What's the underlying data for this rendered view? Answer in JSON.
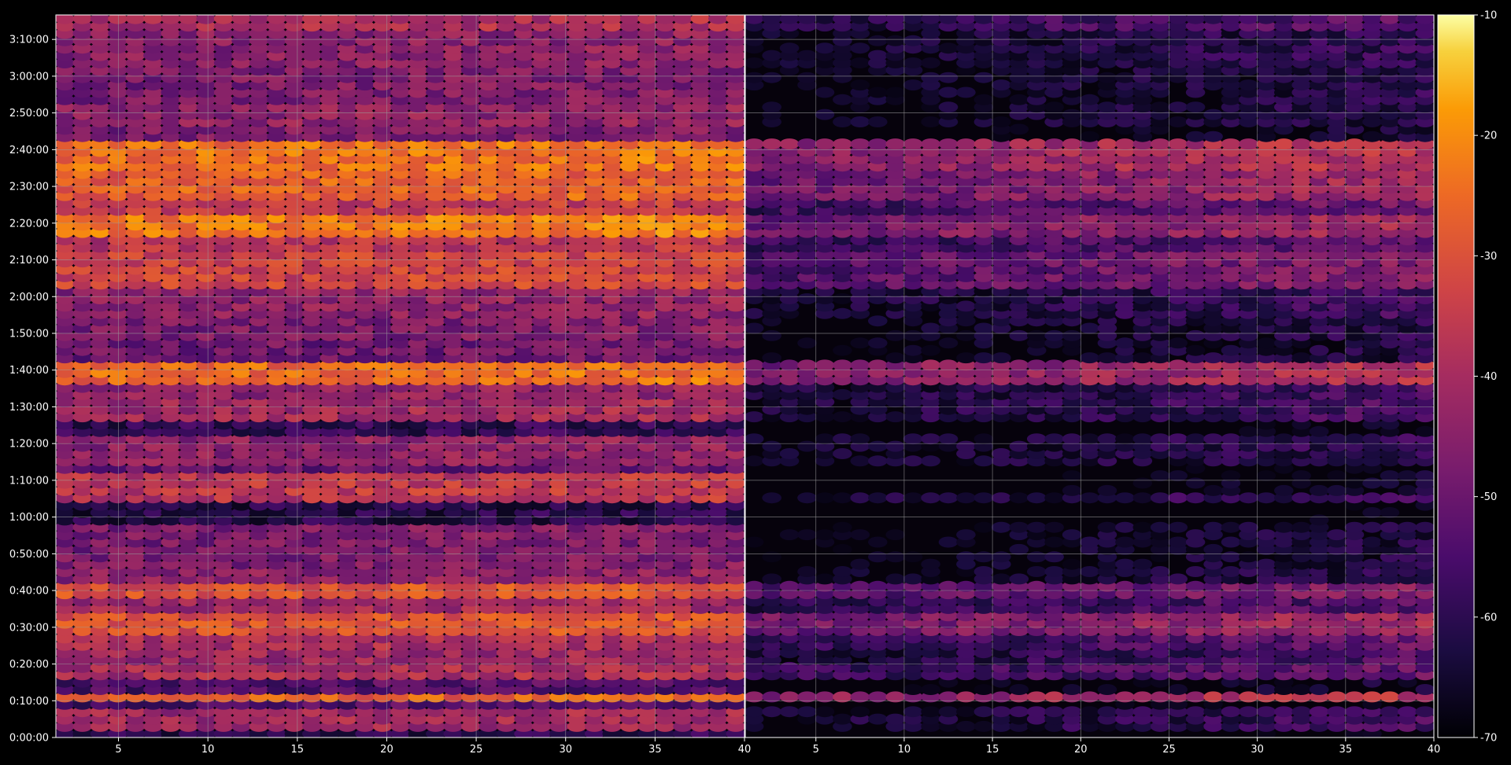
{
  "chart_data": {
    "type": "heatmap",
    "title": "",
    "xlabel": "",
    "ylabel": "",
    "panels": [
      {
        "name": "",
        "x_range": [
          1.5,
          40
        ],
        "x_ticks": [
          5,
          10,
          15,
          20,
          25,
          30,
          35,
          40
        ]
      },
      {
        "name": "",
        "x_range": [
          1,
          40
        ],
        "x_ticks": [
          5,
          10,
          15,
          20,
          25,
          30,
          35,
          40
        ]
      }
    ],
    "y_range_seconds": [
      0,
      11800
    ],
    "y_ticks": [
      {
        "seconds": 0,
        "label": "0:00:00"
      },
      {
        "seconds": 600,
        "label": "0:10:00"
      },
      {
        "seconds": 1200,
        "label": "0:20:00"
      },
      {
        "seconds": 1800,
        "label": "0:30:00"
      },
      {
        "seconds": 2400,
        "label": "0:40:00"
      },
      {
        "seconds": 3000,
        "label": "0:50:00"
      },
      {
        "seconds": 3600,
        "label": "1:00:00"
      },
      {
        "seconds": 4200,
        "label": "1:10:00"
      },
      {
        "seconds": 4800,
        "label": "1:20:00"
      },
      {
        "seconds": 5400,
        "label": "1:30:00"
      },
      {
        "seconds": 6000,
        "label": "1:40:00"
      },
      {
        "seconds": 6600,
        "label": "1:50:00"
      },
      {
        "seconds": 7200,
        "label": "2:00:00"
      },
      {
        "seconds": 7800,
        "label": "2:10:00"
      },
      {
        "seconds": 8400,
        "label": "2:20:00"
      },
      {
        "seconds": 9000,
        "label": "2:30:00"
      },
      {
        "seconds": 9600,
        "label": "2:40:00"
      },
      {
        "seconds": 10200,
        "label": "2:50:00"
      },
      {
        "seconds": 10800,
        "label": "3:00:00"
      },
      {
        "seconds": 11400,
        "label": "3:10:00"
      }
    ],
    "band_profile": [
      {
        "t_start": 0,
        "t_end": 120,
        "left": -62,
        "right": -70
      },
      {
        "t_start": 120,
        "t_end": 450,
        "left": -42,
        "right": -56
      },
      {
        "t_start": 450,
        "t_end": 560,
        "left": -55,
        "right": -68
      },
      {
        "t_start": 560,
        "t_end": 700,
        "left": -28,
        "right": -36
      },
      {
        "t_start": 700,
        "t_end": 960,
        "left": -55,
        "right": -65
      },
      {
        "t_start": 960,
        "t_end": 1240,
        "left": -40,
        "right": -50
      },
      {
        "t_start": 1240,
        "t_end": 1500,
        "left": -43,
        "right": -54
      },
      {
        "t_start": 1500,
        "t_end": 1700,
        "left": -40,
        "right": -50
      },
      {
        "t_start": 1700,
        "t_end": 2000,
        "left": -31,
        "right": -40
      },
      {
        "t_start": 2000,
        "t_end": 2300,
        "left": -42,
        "right": -52
      },
      {
        "t_start": 2300,
        "t_end": 2480,
        "left": -30,
        "right": -45
      },
      {
        "t_start": 2480,
        "t_end": 2800,
        "left": -45,
        "right": -60
      },
      {
        "t_start": 2800,
        "t_end": 3500,
        "left": -48,
        "right": -62
      },
      {
        "t_start": 3500,
        "t_end": 3800,
        "left": -62,
        "right": -70
      },
      {
        "t_start": 3800,
        "t_end": 4000,
        "left": -38,
        "right": -56
      },
      {
        "t_start": 4000,
        "t_end": 4300,
        "left": -37,
        "right": -66
      },
      {
        "t_start": 4300,
        "t_end": 4500,
        "left": -52,
        "right": -69
      },
      {
        "t_start": 4500,
        "t_end": 4900,
        "left": -45,
        "right": -58
      },
      {
        "t_start": 4900,
        "t_end": 5200,
        "left": -60,
        "right": -69
      },
      {
        "t_start": 5200,
        "t_end": 5500,
        "left": -42,
        "right": -55
      },
      {
        "t_start": 5500,
        "t_end": 5800,
        "left": -45,
        "right": -55
      },
      {
        "t_start": 5800,
        "t_end": 6150,
        "left": -26,
        "right": -38
      },
      {
        "t_start": 6150,
        "t_end": 6500,
        "left": -50,
        "right": -62
      },
      {
        "t_start": 6500,
        "t_end": 6900,
        "left": -48,
        "right": -60
      },
      {
        "t_start": 6900,
        "t_end": 7300,
        "left": -45,
        "right": -56
      },
      {
        "t_start": 7300,
        "t_end": 7900,
        "left": -34,
        "right": -45
      },
      {
        "t_start": 7900,
        "t_end": 8200,
        "left": -38,
        "right": -50
      },
      {
        "t_start": 8200,
        "t_end": 8600,
        "left": -24,
        "right": -40
      },
      {
        "t_start": 8600,
        "t_end": 8800,
        "left": -36,
        "right": -48
      },
      {
        "t_start": 8800,
        "t_end": 9300,
        "left": -28,
        "right": -40
      },
      {
        "t_start": 9300,
        "t_end": 9800,
        "left": -25,
        "right": -36
      },
      {
        "t_start": 9800,
        "t_end": 10000,
        "left": -48,
        "right": -65
      },
      {
        "t_start": 10000,
        "t_end": 10400,
        "left": -45,
        "right": -60
      },
      {
        "t_start": 10400,
        "t_end": 10900,
        "left": -48,
        "right": -60
      },
      {
        "t_start": 10900,
        "t_end": 11500,
        "left": -46,
        "right": -58
      },
      {
        "t_start": 11500,
        "t_end": 11800,
        "left": -40,
        "right": -52
      }
    ],
    "colorbar": {
      "colormap": "inferno",
      "range": [
        -70,
        -10
      ],
      "ticks": [
        {
          "value": -10,
          "label": "-10"
        },
        {
          "value": -20,
          "label": "-20"
        },
        {
          "value": -30,
          "label": "-30"
        },
        {
          "value": -40,
          "label": "-40"
        },
        {
          "value": -50,
          "label": "-50"
        },
        {
          "value": -60,
          "label": "-60"
        },
        {
          "value": -70,
          "label": "-70"
        }
      ]
    },
    "grid": true,
    "colors": {
      "background": "#000000",
      "grid": "#9a9a9a",
      "text": "#ffffff"
    }
  }
}
